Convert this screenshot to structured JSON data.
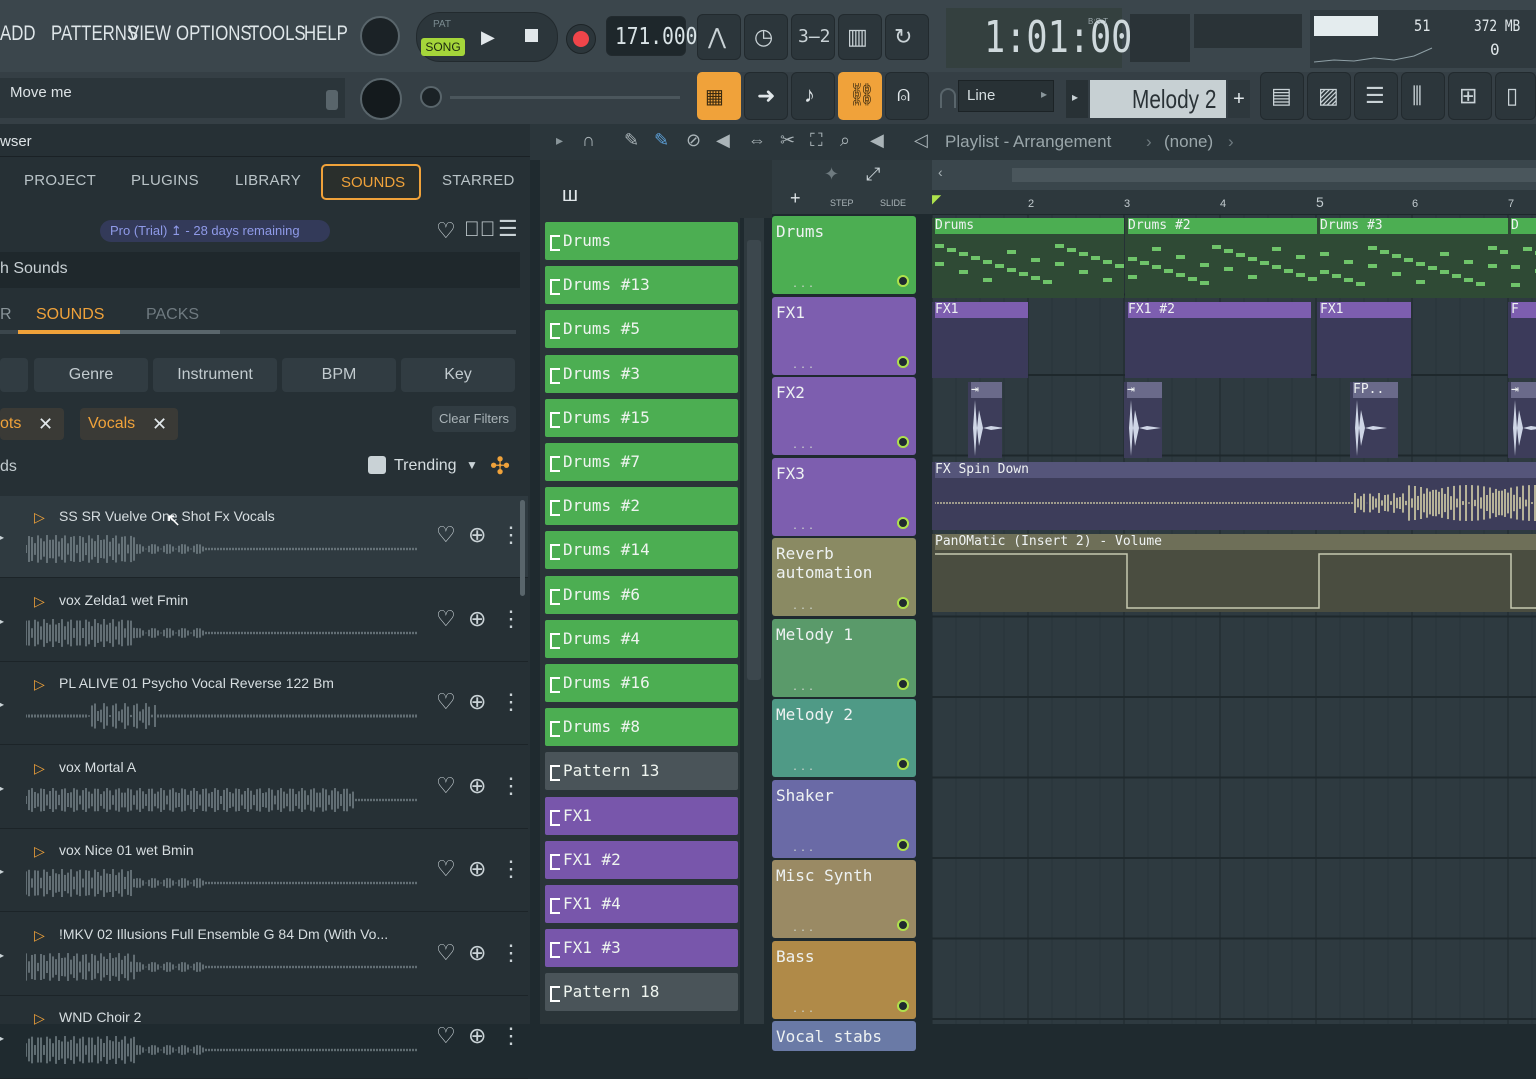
{
  "menu": {
    "items": [
      "ADD",
      "PATTERNS",
      "VIEW",
      "OPTIONS",
      "TOOLS",
      "HELP"
    ]
  },
  "transport": {
    "pat_label": "PAT",
    "song_label": "SONG",
    "tempo": "171.000",
    "time": "1:01:00",
    "time_unit": "B:S:T",
    "cpu": "51",
    "ram": "372 MB",
    "poly": "0"
  },
  "hint": {
    "text": "Move me"
  },
  "snap": {
    "value": "Line"
  },
  "pattern": {
    "name": "Melody 2"
  },
  "browser": {
    "title": "wser",
    "tabs": [
      "PROJECT",
      "PLUGINS",
      "LIBRARY",
      "SOUNDS",
      "STARRED"
    ],
    "active_tab": "SOUNDS",
    "trial_text": "Pro (Trial) ↥ - 28 days remaining",
    "search_label": "h Sounds",
    "subtabs": [
      "R",
      "SOUNDS",
      "PACKS"
    ],
    "filters": [
      "Genre",
      "Instrument",
      "BPM",
      "Key"
    ],
    "chips": [
      "ots",
      "Vocals"
    ],
    "clear_filters": "Clear Filters",
    "results_label": "ds",
    "sort": "Trending",
    "items": [
      {
        "name": "SS SR Vuelve One Shot Fx Vocals"
      },
      {
        "name": "vox Zelda1 wet Fmin"
      },
      {
        "name": "PL ALIVE 01 Psycho Vocal Reverse 122 Bm"
      },
      {
        "name": "vox Mortal A"
      },
      {
        "name": "vox Nice 01 wet Bmin"
      },
      {
        "name": "!MKV 02 Illusions Full Ensemble G 84 Dm (With Vo..."
      },
      {
        "name": "WND Choir 2"
      }
    ]
  },
  "playlist": {
    "title": "Playlist - Arrangement",
    "sep1": "›",
    "sub": "(none)",
    "sep2": "›",
    "step_label": "STEP",
    "slide_label": "SLIDE",
    "ruler": [
      "2",
      "3",
      "4",
      "5",
      "6",
      "7"
    ]
  },
  "patterns": [
    {
      "name": "Drums",
      "color": "#4cae52"
    },
    {
      "name": "Drums #13",
      "color": "#4cae52"
    },
    {
      "name": "Drums #5",
      "color": "#4cae52"
    },
    {
      "name": "Drums #3",
      "color": "#4cae52"
    },
    {
      "name": "Drums #15",
      "color": "#4cae52"
    },
    {
      "name": "Drums #7",
      "color": "#4cae52"
    },
    {
      "name": "Drums #2",
      "color": "#4cae52"
    },
    {
      "name": "Drums #14",
      "color": "#4cae52"
    },
    {
      "name": "Drums #6",
      "color": "#4cae52"
    },
    {
      "name": "Drums #4",
      "color": "#4cae52"
    },
    {
      "name": "Drums #16",
      "color": "#4cae52"
    },
    {
      "name": "Drums #8",
      "color": "#4cae52"
    },
    {
      "name": "Pattern 13",
      "color": "#4a5459"
    },
    {
      "name": "FX1",
      "color": "#7856ab"
    },
    {
      "name": "FX1 #2",
      "color": "#7856ab"
    },
    {
      "name": "FX1 #4",
      "color": "#7856ab"
    },
    {
      "name": "FX1 #3",
      "color": "#7856ab"
    },
    {
      "name": "Pattern 18",
      "color": "#4a5459"
    }
  ],
  "tracks": [
    {
      "name": "Drums",
      "color": "#4cae52"
    },
    {
      "name": "FX1",
      "color": "#7d5eaf"
    },
    {
      "name": "FX2",
      "color": "#7d5eaf"
    },
    {
      "name": "FX3",
      "color": "#7d5eaf"
    },
    {
      "name": "Reverb automation",
      "color": "#8a8a63"
    },
    {
      "name": "Melody 1",
      "color": "#5a9a6a"
    },
    {
      "name": "Melody 2",
      "color": "#4f9a86"
    },
    {
      "name": "Shaker",
      "color": "#6a6aa6"
    },
    {
      "name": "Misc Synth",
      "color": "#9a8a64"
    },
    {
      "name": "Bass",
      "color": "#b08a48"
    },
    {
      "name": "Vocal stabs",
      "color": "#6a7aa6"
    }
  ],
  "clips": {
    "drums": [
      "Drums",
      "Drums #2",
      "Drums #3",
      "D"
    ],
    "fx1": [
      "FX1",
      "FX1 #2",
      "FX1",
      "F"
    ],
    "fx2": [
      "FP.."
    ],
    "fx3": "FX Spin Down",
    "automation": "PanOMatic (Insert 2) - Volume"
  }
}
